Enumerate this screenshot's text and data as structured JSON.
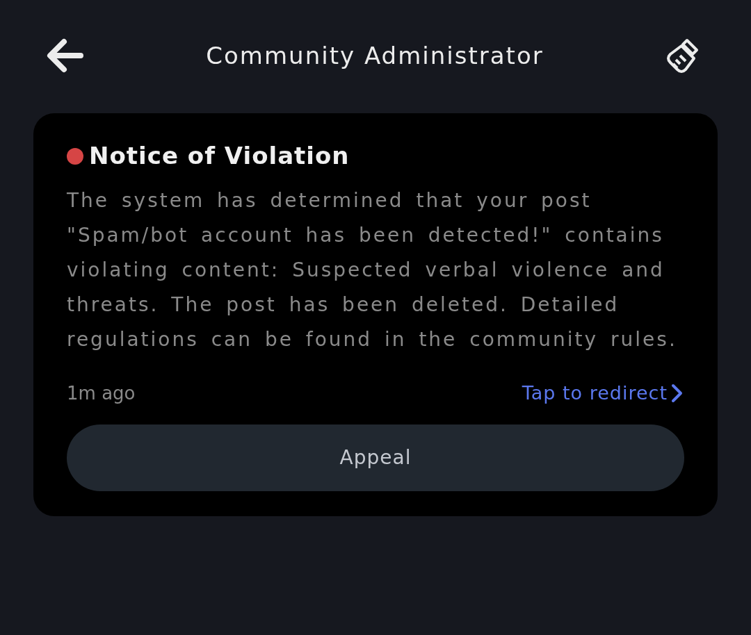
{
  "header": {
    "title": "Community Administrator"
  },
  "notice": {
    "title": "Notice of Violation",
    "body": "The system has determined that your post \"Spam/bot account has been detected!\" contains violating content: Suspected verbal violence and threats. The post has been deleted. Detailed regulations can be found in the community rules.",
    "time": "1m ago",
    "link": "Tap to redirect",
    "button": "Appeal"
  }
}
